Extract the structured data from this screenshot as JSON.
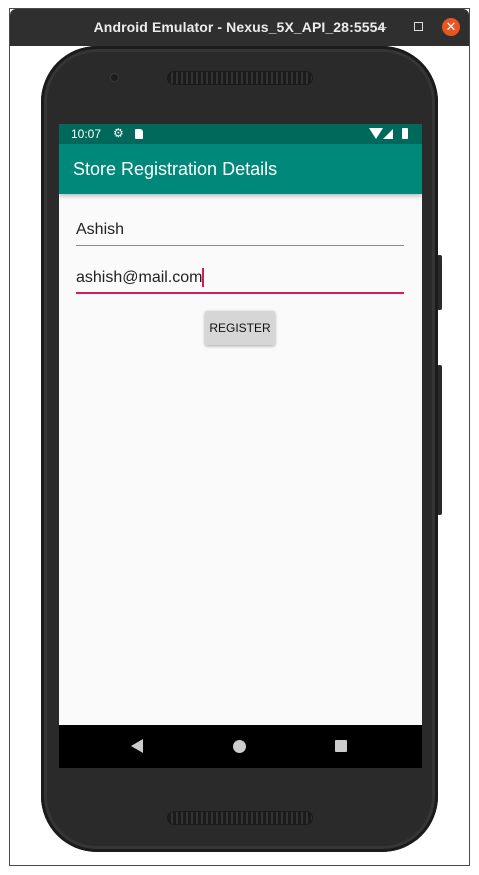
{
  "window": {
    "title": "Android Emulator - Nexus_5X_API_28:5554",
    "minimize_label": "–",
    "close_label": "✕"
  },
  "status_bar": {
    "time": "10:07",
    "icons": [
      "gear-icon",
      "sd-card-icon",
      "wifi-icon",
      "signal-icon",
      "battery-icon"
    ]
  },
  "app_bar": {
    "title": "Store Registration Details"
  },
  "form": {
    "name_value": "Ashish",
    "email_value": "ashish@mail.com",
    "register_label": "REGISTER"
  },
  "nav_bar": {
    "icons": [
      "back-icon",
      "home-icon",
      "recents-icon"
    ]
  },
  "colors": {
    "status_bar": "#00695c",
    "app_bar": "#00897b",
    "accent": "#d81b60",
    "close_button": "#e95420"
  }
}
